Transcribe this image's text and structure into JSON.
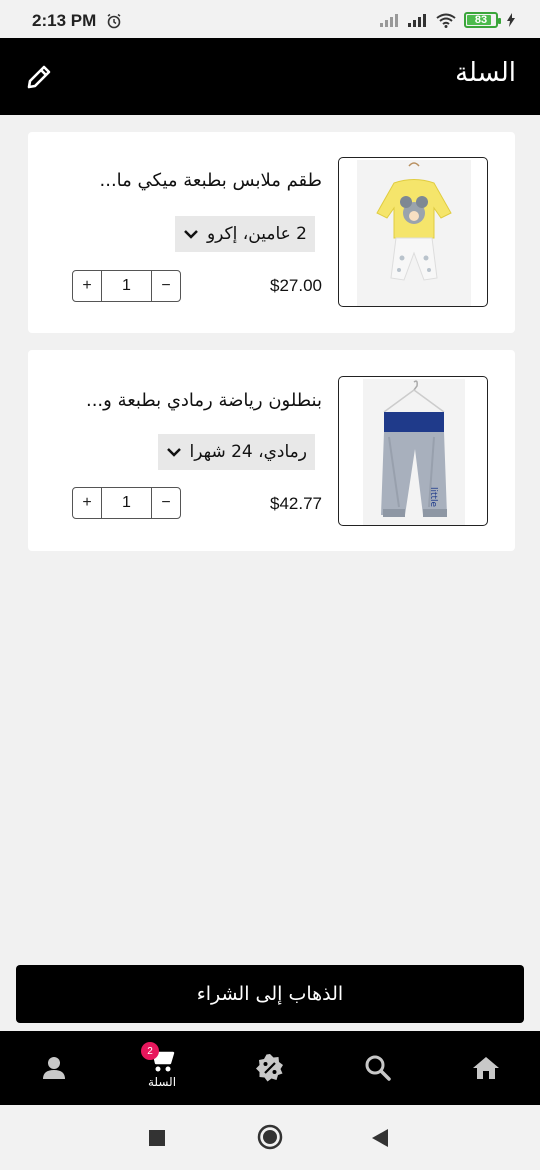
{
  "status_bar": {
    "time": "2:13 PM",
    "battery": "83"
  },
  "header": {
    "title": "السلة"
  },
  "cart_items": [
    {
      "title": "طقم ملابس بطبعة ميكي ما...",
      "variant": "2 عامين، إكرو",
      "price": "$27.00",
      "quantity": "1"
    },
    {
      "title": "بنطلون رياضة رمادي بطبعة و...",
      "variant": "رمادي، 24 شهرا",
      "price": "$42.77",
      "quantity": "1"
    }
  ],
  "qty_controls": {
    "plus": "+",
    "minus": "−"
  },
  "checkout": {
    "label": "الذهاب إلى الشراء"
  },
  "bottom_nav": {
    "cart_label": "السلة",
    "cart_badge": "2",
    "items": [
      "profile-icon",
      "cart-icon",
      "discount-icon",
      "search-icon",
      "home-icon"
    ]
  },
  "colors": {
    "primary": "#000000",
    "background": "#f1f1f1",
    "badge": "#e8175d",
    "battery": "#4cbb4c"
  }
}
